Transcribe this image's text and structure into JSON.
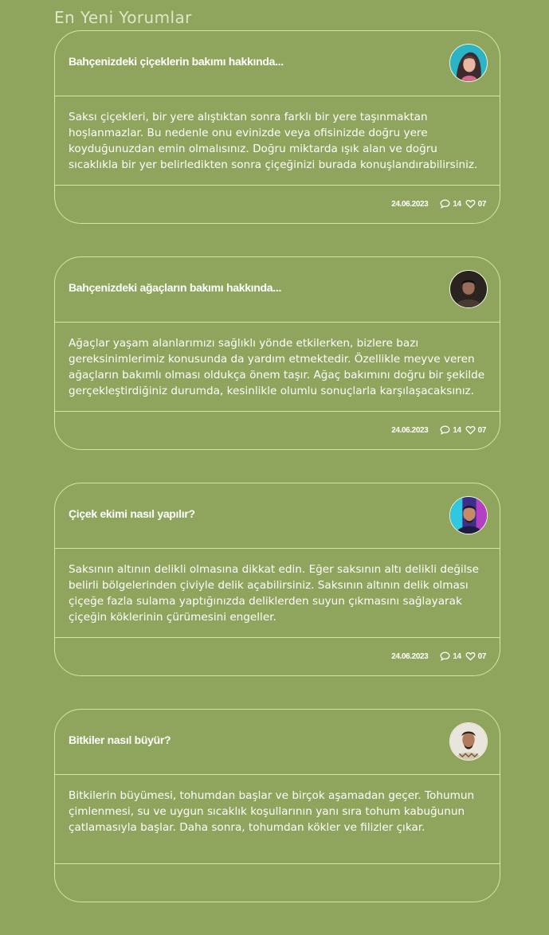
{
  "page": {
    "title": "En Yeni Yorumlar"
  },
  "comments": [
    {
      "title": "Bahçenizdeki çiçeklerin bakımı hakkında...",
      "text": "Saksı çiçekleri, bir yere alıştıktan sonra farklı bir yere taşınmaktan hoşlanmazlar. Bu nedenle onu evinizde veya ofisinizde doğru yere koyduğunuzdan emin olmalısınız. Doğru miktarda ışık alan ve doğru sıcaklıkla bir yer belirledikten sonra çiçeğinizi burada konuşlandırabilirsiniz.",
      "date": "24.06.2023",
      "comment_count": "14",
      "like_count": "07",
      "avatar": "woman-portrait-teal"
    },
    {
      "title": "Bahçenizdeki ağaçların bakımı hakkında...",
      "text": "Ağaçlar yaşam alanlarımızı sağlıklı yönde etkilerken, bizlere bazı gereksinimlerimiz konusunda da yardım etmektedir. Özellikle meyve veren ağaçların bakımlı olması oldukça önem taşır. Ağaç bakımını doğru bir şekilde gerçekleştirdiğiniz durumda, kesinlikle olumlu sonuçlarla karşılaşacaksınız.",
      "date": "24.06.2023",
      "comment_count": "14",
      "like_count": "07",
      "avatar": "man-portrait-dark"
    },
    {
      "title": "Çiçek ekimi nasıl yapılır?",
      "text": "Saksının altının delikli olmasına dikkat edin. Eğer saksının altı delikli değilse belirli bölgelerinden çiviyle delik açabilirsiniz. Saksının altının delik olması çiçeğe fazla sulama yaptığınızda deliklerden suyun çıkmasını sağlayarak çiçeğin köklerinin çürümesini engeller.",
      "date": "24.06.2023",
      "comment_count": "14",
      "like_count": "07",
      "avatar": "man-portrait-neon"
    },
    {
      "title": "Bitkiler nasıl büyür?",
      "text": "Bitkilerin büyümesi, tohumdan başlar ve birçok aşamadan geçer. Tohumun çimlenmesi, su ve uygun sıcaklık koşullarının yanı sıra tohum kabuğunun çatlamasıyla başlar. Daha sonra, tohumdan kökler ve filizler çıkar.",
      "date": "",
      "comment_count": "",
      "like_count": "",
      "avatar": "man-portrait-light"
    }
  ]
}
